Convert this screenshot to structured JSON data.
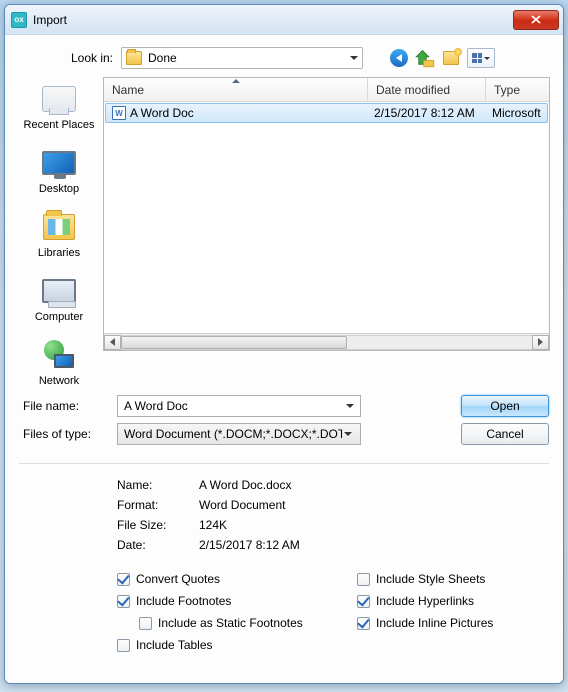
{
  "title": "Import",
  "lookin": {
    "label": "Look in:",
    "value": "Done"
  },
  "columns": {
    "name": "Name",
    "date": "Date modified",
    "type": "Type"
  },
  "files": [
    {
      "name": "A Word Doc",
      "date": "2/15/2017 8:12 AM",
      "type": "Microsoft"
    }
  ],
  "filename": {
    "label": "File name:",
    "value": "A Word Doc"
  },
  "filetype": {
    "label": "Files of type:",
    "value": "Word Document (*.DOCM;*.DOCX;*.DOTM;*.D"
  },
  "buttons": {
    "open": "Open",
    "cancel": "Cancel"
  },
  "places": {
    "recent": "Recent Places",
    "desktop": "Desktop",
    "libraries": "Libraries",
    "computer": "Computer",
    "network": "Network"
  },
  "meta": {
    "name_label": "Name:",
    "name": "A Word Doc.docx",
    "format_label": "Format:",
    "format": "Word Document",
    "size_label": "File Size:",
    "size": "124K",
    "date_label": "Date:",
    "date": "2/15/2017 8:12 AM"
  },
  "opts": {
    "convert_quotes": "Convert Quotes",
    "include_footnotes": "Include Footnotes",
    "include_static": "Include as Static Footnotes",
    "include_tables": "Include Tables",
    "include_styles": "Include Style Sheets",
    "include_hyperlinks": "Include Hyperlinks",
    "include_pictures": "Include Inline Pictures"
  }
}
